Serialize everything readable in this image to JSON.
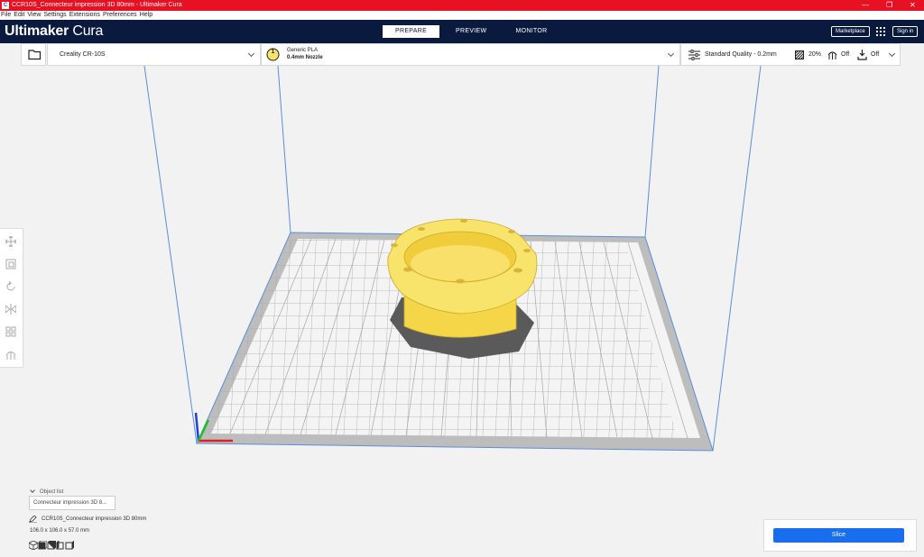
{
  "window": {
    "title": "CCR10S_Connecteur impression 3D 80mm - Ultimaker Cura",
    "minimize": "—",
    "maximize": "❐",
    "close": "✕"
  },
  "menu": {
    "items": [
      "File",
      "Edit",
      "View",
      "Settings",
      "Extensions",
      "Preferences",
      "Help"
    ]
  },
  "header": {
    "brand_bold": "Ultimaker",
    "brand_thin": " Cura",
    "tabs": [
      {
        "label": "PREPARE",
        "active": true
      },
      {
        "label": "PREVIEW",
        "active": false
      },
      {
        "label": "MONITOR",
        "active": false
      }
    ],
    "marketplace_label": "Marketplace",
    "signin_label": "Sign in"
  },
  "toolbar": {
    "printer_name": "Creality CR-10S",
    "extruder_number": "1",
    "material_name": "Generic PLA",
    "nozzle": "0.4mm Nozzle",
    "quality": "Standard Quality - 0.2mm",
    "infill": "20%",
    "support": "Off",
    "adhesion": "Off"
  },
  "object_list": {
    "title": "Object list",
    "item": "Connecteur impression 3D 8...",
    "object_name": "CCR10S_Connecteur impression 3D 80mm",
    "dimensions": "106.0 x 106.0 x 57.0 mm"
  },
  "slice": {
    "label": "Slice"
  },
  "colors": {
    "accent": "#196ef0",
    "header_bg": "#0a1a3f",
    "titlebar": "#e81123",
    "model": "#f8e46a",
    "volume_lines": "#5a8fd8"
  },
  "icons": {
    "folder": "folder-icon",
    "settings": "sliders-icon",
    "infill": "infill-icon",
    "support": "support-icon",
    "adhesion": "adhesion-icon"
  }
}
